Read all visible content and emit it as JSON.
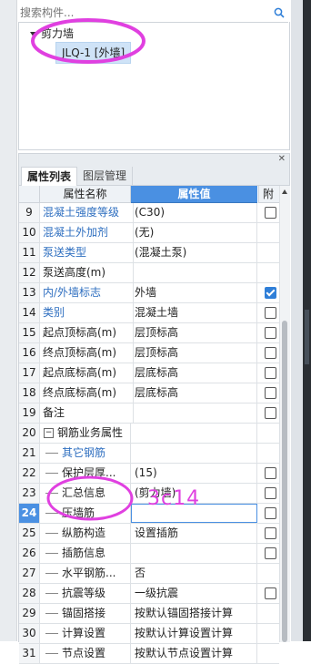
{
  "search": {
    "placeholder": "搜索构件..."
  },
  "tree": {
    "root_label": "剪力墙",
    "child_label": "JLQ-1 [外墙]"
  },
  "panel": {
    "tabs": [
      "属性列表",
      "图层管理"
    ],
    "headers": {
      "name": "属性名称",
      "value": "属性值",
      "attach": "附"
    }
  },
  "rows": [
    {
      "num": "9",
      "name": "混凝土强度等级",
      "value": "(C30)",
      "blue": true,
      "check": false,
      "indent": 0
    },
    {
      "num": "10",
      "name": "混凝土外加剂",
      "value": "(无)",
      "blue": true,
      "check": null,
      "indent": 0
    },
    {
      "num": "11",
      "name": "泵送类型",
      "value": "(混凝土泵)",
      "blue": true,
      "check": null,
      "indent": 0
    },
    {
      "num": "12",
      "name": "泵送高度(m)",
      "value": "",
      "blue": false,
      "check": null,
      "indent": 0
    },
    {
      "num": "13",
      "name": "内/外墙标志",
      "value": "外墙",
      "blue": true,
      "check": true,
      "indent": 0
    },
    {
      "num": "14",
      "name": "类别",
      "value": "混凝土墙",
      "blue": true,
      "check": false,
      "indent": 0
    },
    {
      "num": "15",
      "name": "起点顶标高(m)",
      "value": "层顶标高",
      "blue": false,
      "check": false,
      "indent": 0
    },
    {
      "num": "16",
      "name": "终点顶标高(m)",
      "value": "层顶标高",
      "blue": false,
      "check": false,
      "indent": 0
    },
    {
      "num": "17",
      "name": "起点底标高(m)",
      "value": "层底标高",
      "blue": false,
      "check": false,
      "indent": 0
    },
    {
      "num": "18",
      "name": "终点底标高(m)",
      "value": "层底标高",
      "blue": false,
      "check": false,
      "indent": 0
    },
    {
      "num": "19",
      "name": "备注",
      "value": "",
      "blue": false,
      "check": false,
      "indent": 0
    },
    {
      "num": "20",
      "name": "钢筋业务属性",
      "value": "",
      "blue": false,
      "check": null,
      "indent": 1,
      "expander": "−"
    },
    {
      "num": "21",
      "name": "其它钢筋",
      "value": "",
      "blue": true,
      "check": null,
      "indent": 2
    },
    {
      "num": "22",
      "name": "保护层厚...",
      "value": "(15)",
      "blue": false,
      "check": false,
      "indent": 2
    },
    {
      "num": "23",
      "name": "汇总信息",
      "value": "(剪力墙)",
      "blue": false,
      "check": false,
      "indent": 2
    },
    {
      "num": "24",
      "name": "压墙筋",
      "value": "",
      "blue": false,
      "check": false,
      "indent": 2,
      "selected": true
    },
    {
      "num": "25",
      "name": "纵筋构造",
      "value": "设置插筋",
      "blue": false,
      "check": false,
      "indent": 2
    },
    {
      "num": "26",
      "name": "插筋信息",
      "value": "",
      "blue": false,
      "check": false,
      "indent": 2
    },
    {
      "num": "27",
      "name": "水平钢筋...",
      "value": "否",
      "blue": false,
      "check": null,
      "indent": 2
    },
    {
      "num": "28",
      "name": "抗震等级",
      "value": "一级抗震",
      "blue": false,
      "check": false,
      "indent": 2
    },
    {
      "num": "29",
      "name": "锚固搭接",
      "value": "按默认锚固搭接计算",
      "blue": false,
      "check": null,
      "indent": 2
    },
    {
      "num": "30",
      "name": "计算设置",
      "value": "按默认计算设置计算",
      "blue": false,
      "check": null,
      "indent": 2
    },
    {
      "num": "31",
      "name": "节点设置",
      "value": "按默认节点设置计算",
      "blue": false,
      "check": null,
      "indent": 2
    }
  ],
  "annotation": {
    "handwritten_text": "3c14",
    "color": "#e040e0"
  },
  "colors": {
    "accent": "#4a90e2",
    "blue_text": "#2f6fc0"
  }
}
